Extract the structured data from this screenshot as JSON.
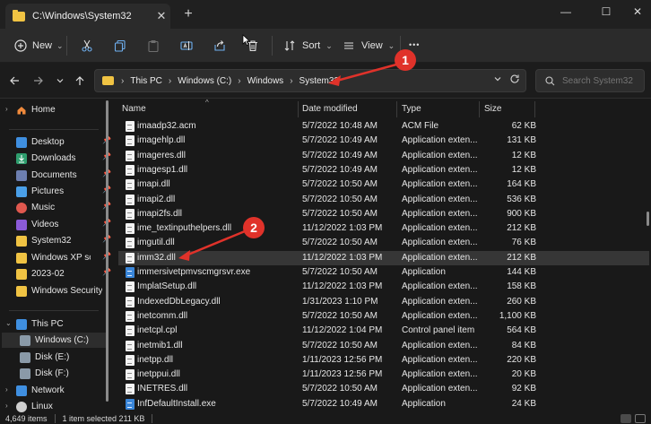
{
  "window": {
    "tab_title": "C:\\Windows\\System32",
    "close_tab_glyph": "✕",
    "new_tab_glyph": "+",
    "minimize_glyph": "—",
    "maximize_glyph": "☐",
    "close_glyph": "✕"
  },
  "toolbar": {
    "new_label": "New",
    "sort_label": "Sort",
    "view_label": "View",
    "more_glyph": "•••",
    "caret": "⌄"
  },
  "address": {
    "crumbs": [
      "This PC",
      "Windows (C:)",
      "Windows",
      "System32"
    ],
    "separator": "›"
  },
  "search": {
    "placeholder": "Search System32"
  },
  "sidebar": {
    "items": [
      {
        "label": "Home",
        "icon": "home-icon"
      },
      {
        "label": "Desktop",
        "icon": "desktop-icon"
      },
      {
        "label": "Downloads",
        "icon": "download-icon"
      },
      {
        "label": "Documents",
        "icon": "documents-icon"
      },
      {
        "label": "Pictures",
        "icon": "pictures-icon"
      },
      {
        "label": "Music",
        "icon": "music-icon"
      },
      {
        "label": "Videos",
        "icon": "videos-icon"
      },
      {
        "label": "System32",
        "icon": "folder-icon"
      },
      {
        "label": "Windows XP sc",
        "icon": "folder-icon"
      },
      {
        "label": "2023-02",
        "icon": "folder-icon"
      },
      {
        "label": "Windows Security",
        "icon": "folder-icon"
      },
      {
        "label": "This PC",
        "icon": "pc-icon"
      },
      {
        "label": "Windows (C:)",
        "icon": "drive-icon"
      },
      {
        "label": "Disk (E:)",
        "icon": "drive-icon"
      },
      {
        "label": "Disk (F:)",
        "icon": "drive-icon"
      },
      {
        "label": "Network",
        "icon": "network-icon"
      },
      {
        "label": "Linux",
        "icon": "linux-icon"
      }
    ]
  },
  "columns": {
    "name": "Name",
    "date": "Date modified",
    "type": "Type",
    "size": "Size"
  },
  "files": [
    {
      "name": "imaadp32.acm",
      "date": "5/7/2022 10:48 AM",
      "type": "ACM File",
      "size": "62 KB"
    },
    {
      "name": "imagehlp.dll",
      "date": "5/7/2022 10:49 AM",
      "type": "Application exten...",
      "size": "131 KB"
    },
    {
      "name": "imageres.dll",
      "date": "5/7/2022 10:49 AM",
      "type": "Application exten...",
      "size": "12 KB"
    },
    {
      "name": "imagesp1.dll",
      "date": "5/7/2022 10:49 AM",
      "type": "Application exten...",
      "size": "12 KB"
    },
    {
      "name": "imapi.dll",
      "date": "5/7/2022 10:50 AM",
      "type": "Application exten...",
      "size": "164 KB"
    },
    {
      "name": "imapi2.dll",
      "date": "5/7/2022 10:50 AM",
      "type": "Application exten...",
      "size": "536 KB"
    },
    {
      "name": "imapi2fs.dll",
      "date": "5/7/2022 10:50 AM",
      "type": "Application exten...",
      "size": "900 KB"
    },
    {
      "name": "ime_textinputhelpers.dll",
      "date": "11/12/2022 1:03 PM",
      "type": "Application exten...",
      "size": "212 KB"
    },
    {
      "name": "imgutil.dll",
      "date": "5/7/2022 10:50 AM",
      "type": "Application exten...",
      "size": "76 KB"
    },
    {
      "name": "imm32.dll",
      "date": "11/12/2022 1:03 PM",
      "type": "Application exten...",
      "size": "212 KB"
    },
    {
      "name": "immersivetpmvscmgrsvr.exe",
      "date": "5/7/2022 10:50 AM",
      "type": "Application",
      "size": "144 KB"
    },
    {
      "name": "ImplatSetup.dll",
      "date": "11/12/2022 1:03 PM",
      "type": "Application exten...",
      "size": "158 KB"
    },
    {
      "name": "IndexedDbLegacy.dll",
      "date": "1/31/2023 1:10 PM",
      "type": "Application exten...",
      "size": "260 KB"
    },
    {
      "name": "inetcomm.dll",
      "date": "5/7/2022 10:50 AM",
      "type": "Application exten...",
      "size": "1,100 KB"
    },
    {
      "name": "inetcpl.cpl",
      "date": "11/12/2022 1:04 PM",
      "type": "Control panel item",
      "size": "564 KB"
    },
    {
      "name": "inetmib1.dll",
      "date": "5/7/2022 10:50 AM",
      "type": "Application exten...",
      "size": "84 KB"
    },
    {
      "name": "inetpp.dll",
      "date": "1/11/2023 12:56 PM",
      "type": "Application exten...",
      "size": "220 KB"
    },
    {
      "name": "inetppui.dll",
      "date": "1/11/2023 12:56 PM",
      "type": "Application exten...",
      "size": "20 KB"
    },
    {
      "name": "INETRES.dll",
      "date": "5/7/2022 10:50 AM",
      "type": "Application exten...",
      "size": "92 KB"
    },
    {
      "name": "InfDefaultInstall.exe",
      "date": "5/7/2022 10:49 AM",
      "type": "Application",
      "size": "24 KB"
    }
  ],
  "status": {
    "item_count": "4,649 items",
    "selection": "1 item selected  211 KB"
  },
  "annotations": {
    "badge1": "1",
    "badge2": "2",
    "color": "#e0322a"
  }
}
